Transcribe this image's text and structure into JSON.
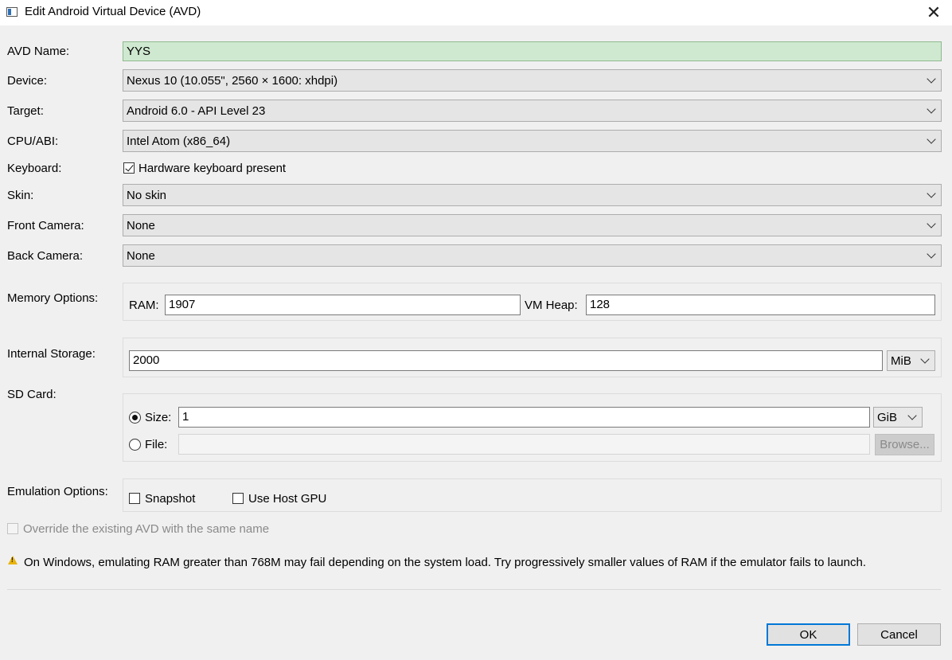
{
  "window": {
    "title": "Edit Android Virtual Device (AVD)",
    "close_icon": "close-icon"
  },
  "form": {
    "avd_name": {
      "label": "AVD Name:",
      "value": "YYS"
    },
    "device": {
      "label": "Device:",
      "value": "Nexus 10 (10.055\", 2560 × 1600: xhdpi)"
    },
    "target": {
      "label": "Target:",
      "value": "Android 6.0 - API Level 23"
    },
    "cpu_abi": {
      "label": "CPU/ABI:",
      "value": "Intel Atom (x86_64)"
    },
    "keyboard": {
      "label": "Keyboard:",
      "checkbox_label": "Hardware keyboard present",
      "checked": true
    },
    "skin": {
      "label": "Skin:",
      "value": "No skin"
    },
    "front_camera": {
      "label": "Front Camera:",
      "value": "None"
    },
    "back_camera": {
      "label": "Back Camera:",
      "value": "None"
    },
    "memory": {
      "label": "Memory Options:",
      "ram_label": "RAM:",
      "ram_value": "1907",
      "vm_heap_label": "VM Heap:",
      "vm_heap_value": "128"
    },
    "internal_storage": {
      "label": "Internal Storage:",
      "value": "2000",
      "unit": "MiB"
    },
    "sd_card": {
      "label": "SD Card:",
      "size_label": "Size:",
      "size_value": "1",
      "size_unit": "GiB",
      "size_selected": true,
      "file_label": "File:",
      "file_value": "",
      "browse_label": "Browse..."
    },
    "emulation": {
      "label": "Emulation Options:",
      "snapshot_label": "Snapshot",
      "snapshot_checked": false,
      "host_gpu_label": "Use Host GPU",
      "host_gpu_checked": false
    },
    "override": {
      "label": "Override the existing AVD with the same name",
      "checked": false,
      "enabled": false
    }
  },
  "warning": {
    "icon": "warning-icon",
    "text": "On Windows, emulating RAM greater than 768M may fail depending on the system load. Try progressively smaller values of RAM if the emulator fails to launch."
  },
  "buttons": {
    "ok": "OK",
    "cancel": "Cancel"
  }
}
